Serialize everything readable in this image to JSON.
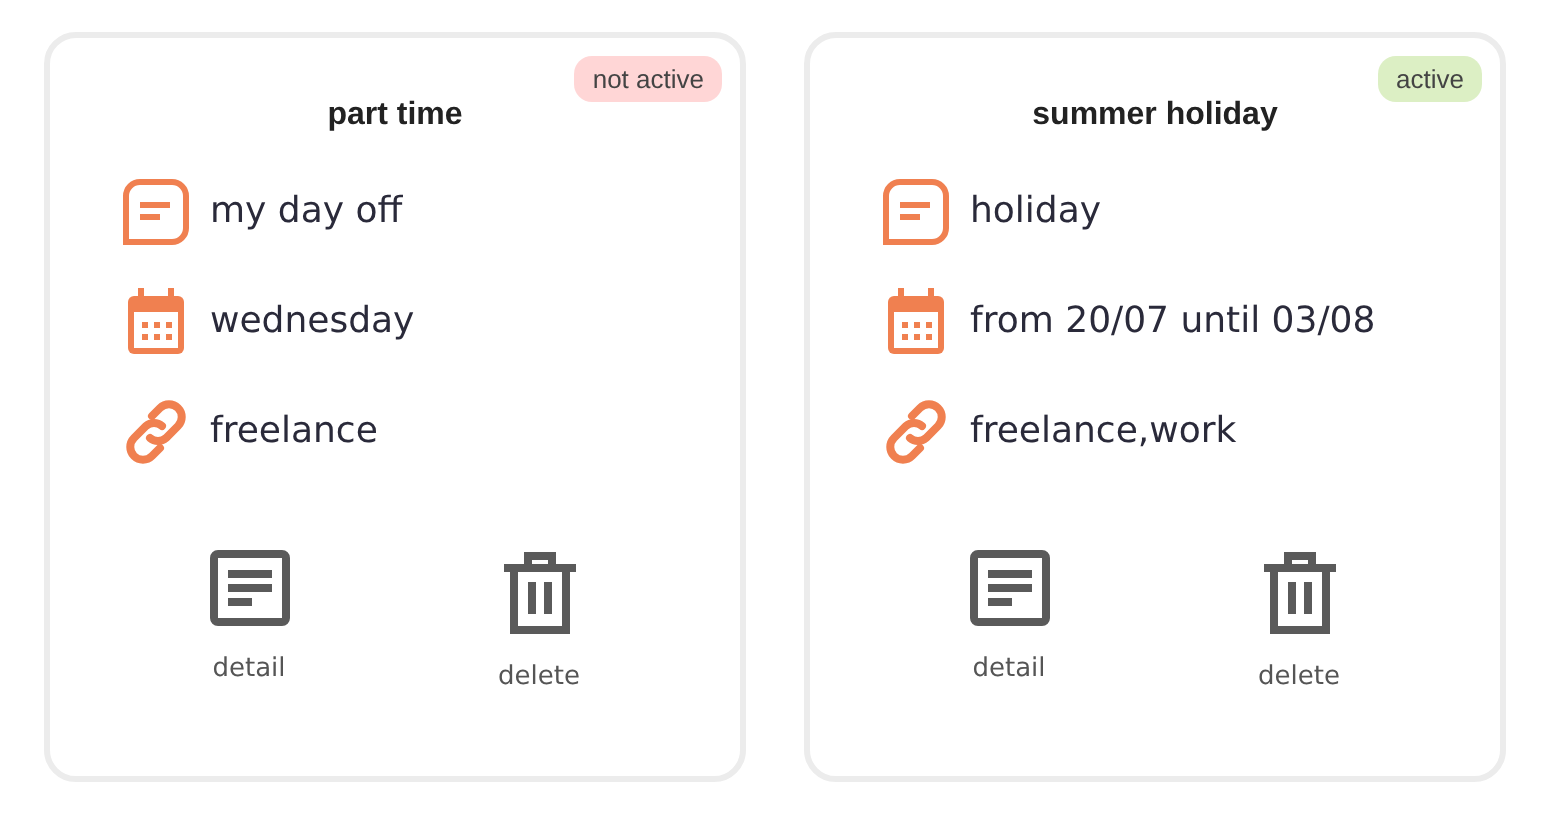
{
  "cards": [
    {
      "title": "part time",
      "status": {
        "label": "not active",
        "active": false
      },
      "rows": [
        {
          "kind": "note",
          "text": "my day off"
        },
        {
          "kind": "date",
          "text": "wednesday"
        },
        {
          "kind": "tags",
          "text": "freelance"
        }
      ],
      "actions": [
        {
          "kind": "detail",
          "label": "detail"
        },
        {
          "kind": "delete",
          "label": "delete"
        }
      ]
    },
    {
      "title": "summer holiday",
      "status": {
        "label": "active",
        "active": true
      },
      "rows": [
        {
          "kind": "note",
          "text": "holiday"
        },
        {
          "kind": "date",
          "text": "from 20/07 until 03/08"
        },
        {
          "kind": "tags",
          "text": "freelance,work"
        }
      ],
      "actions": [
        {
          "kind": "detail",
          "label": "detail"
        },
        {
          "kind": "delete",
          "label": "delete"
        }
      ]
    }
  ]
}
